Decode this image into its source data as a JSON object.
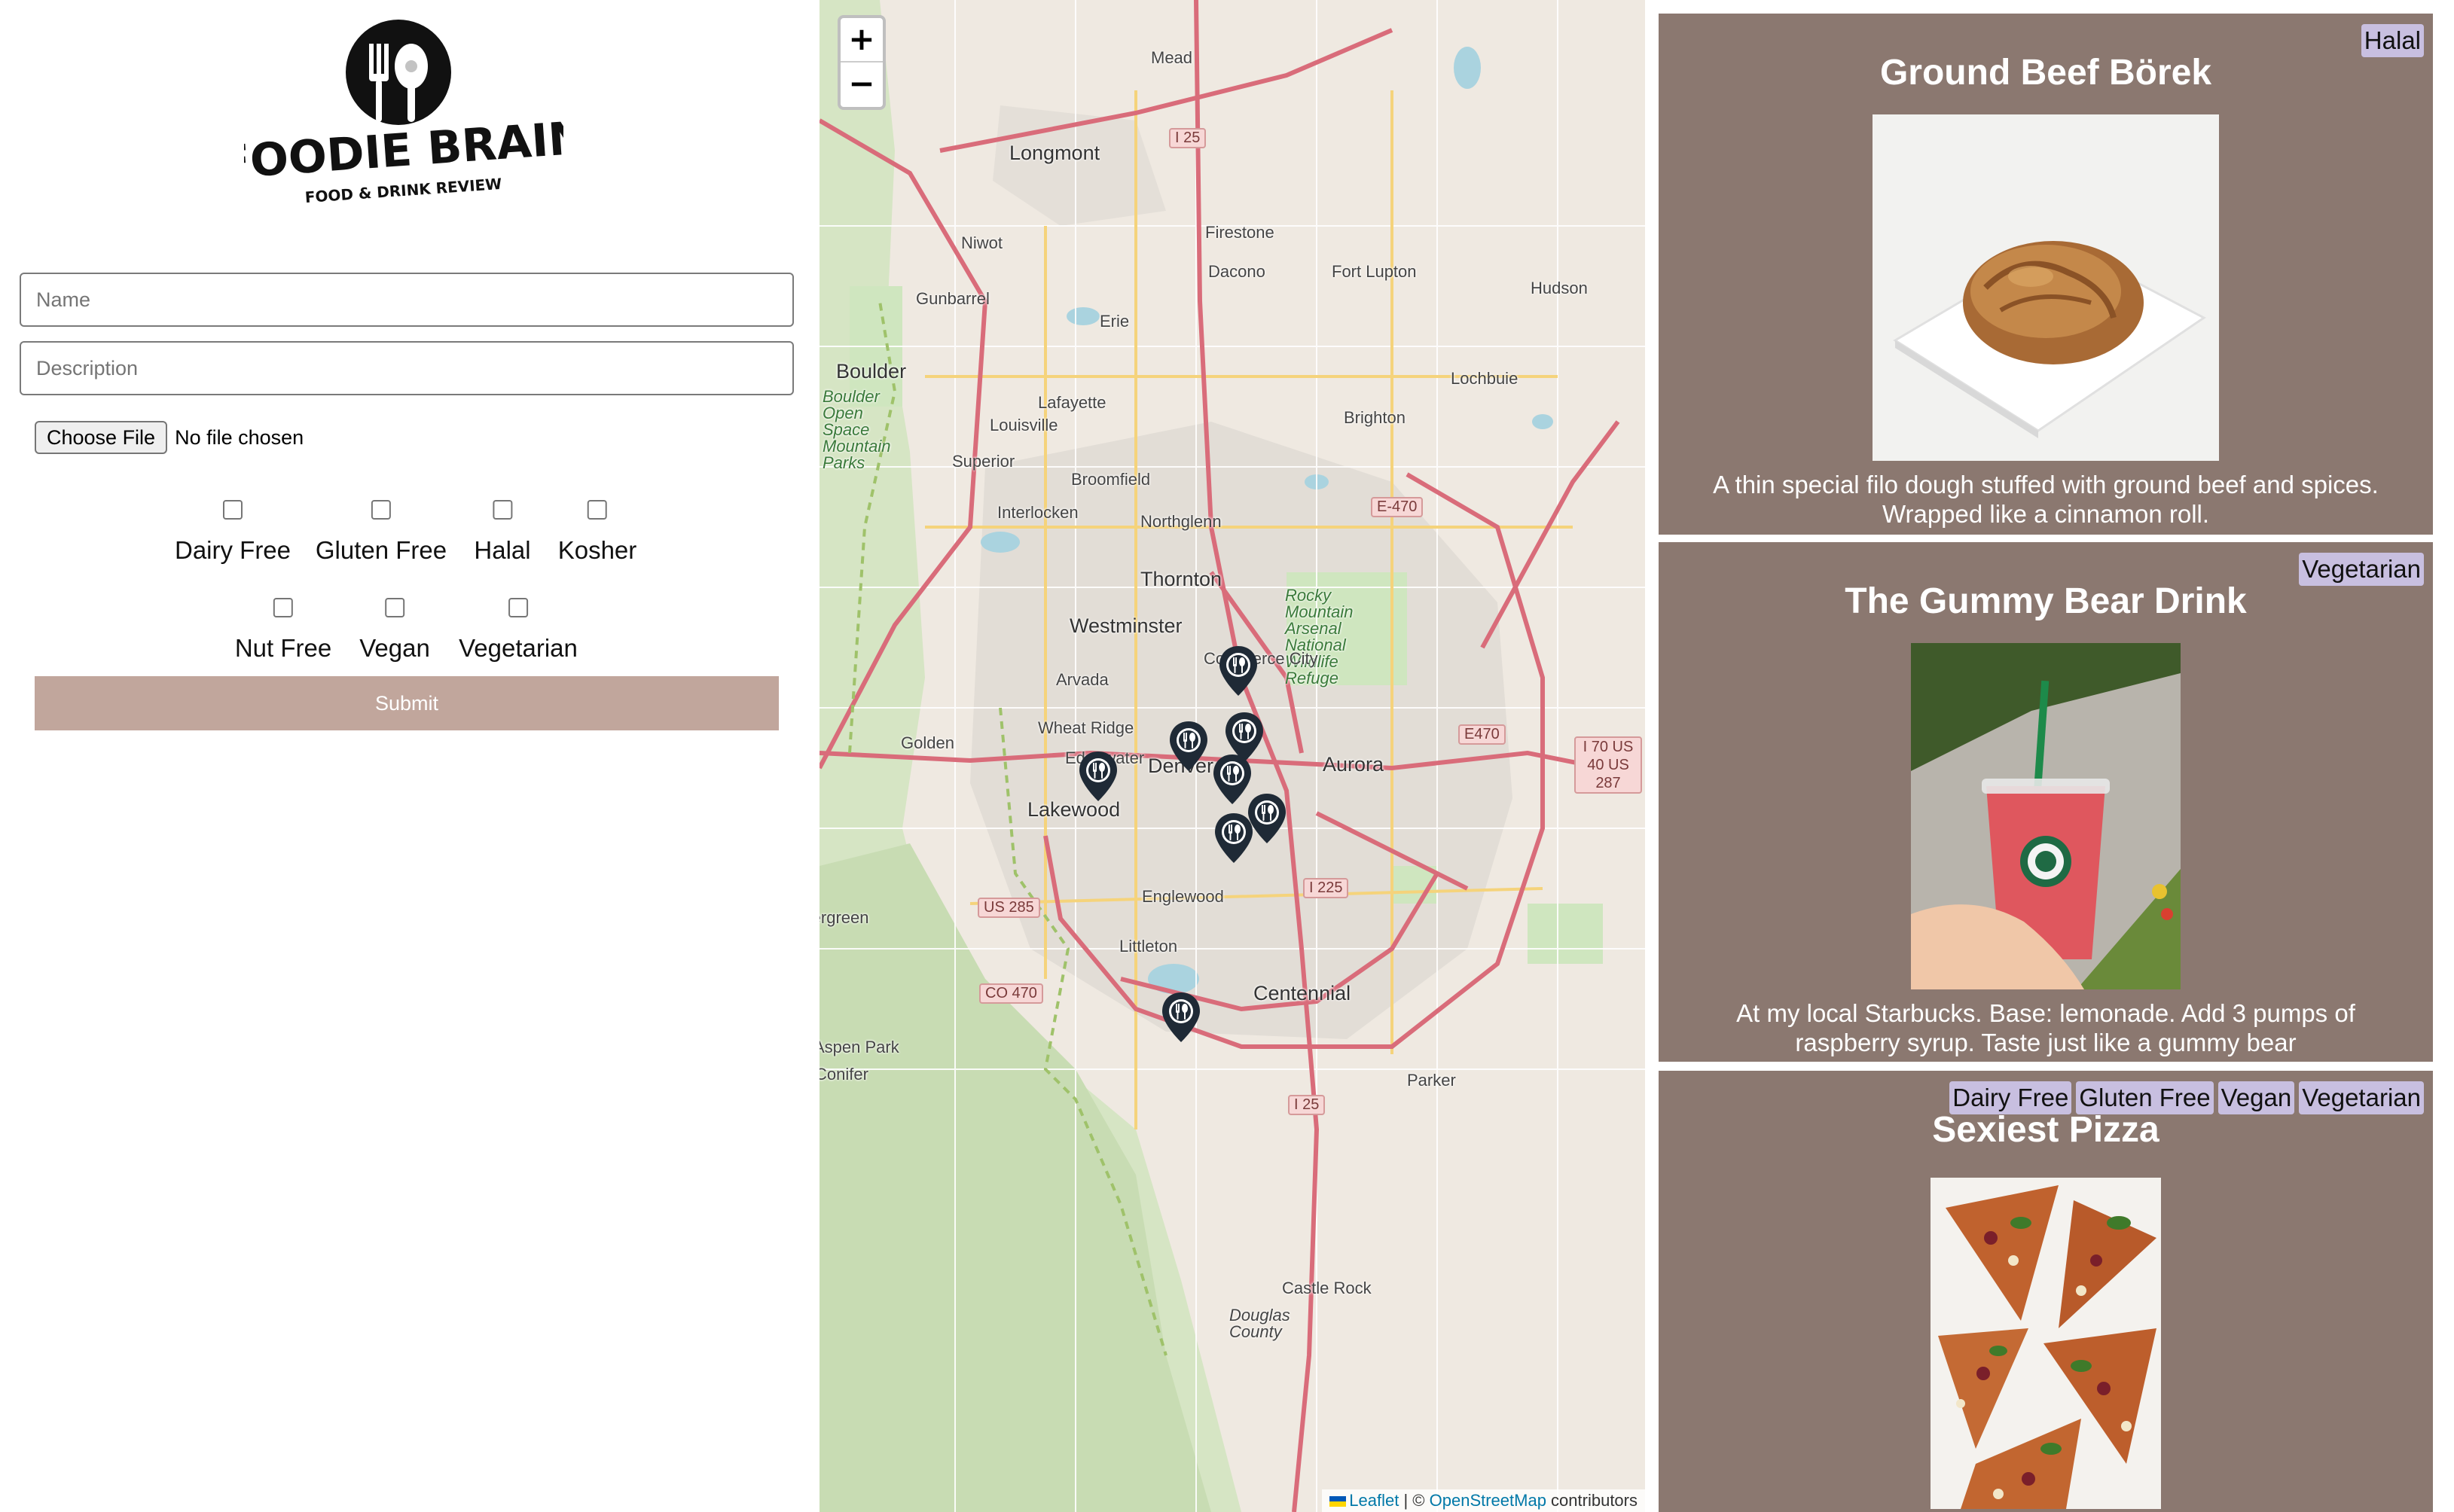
{
  "brand": {
    "name": "FOODIE BRAIN",
    "tagline": "FOOD & DRINK REVIEW"
  },
  "form": {
    "name_placeholder": "Name",
    "description_placeholder": "Description",
    "file_button_label": "Choose File",
    "file_status": "No file chosen",
    "checkbox_row_1": [
      {
        "label": "Dairy Free",
        "checked": false
      },
      {
        "label": "Gluten Free",
        "checked": false
      },
      {
        "label": "Halal",
        "checked": false
      },
      {
        "label": "Kosher",
        "checked": false
      }
    ],
    "checkbox_row_2": [
      {
        "label": "Nut Free",
        "checked": false
      },
      {
        "label": "Vegan",
        "checked": false
      },
      {
        "label": "Vegetarian",
        "checked": false
      }
    ],
    "submit_label": "Submit",
    "submit_color": "#c1a69c"
  },
  "map": {
    "zoom_in_label": "+",
    "zoom_out_label": "−",
    "attribution": {
      "leaflet": "Leaflet",
      "separator": " | © ",
      "osm": "OpenStreetMap",
      "suffix": " contributors"
    },
    "place_labels": {
      "mead": "Mead",
      "longmont": "Longmont",
      "niwot": "Niwot",
      "firestone": "Firestone",
      "dacono": "Dacono",
      "fort_lupton": "Fort Lupton",
      "hudson": "Hudson",
      "gunbarrel": "Gunbarrel",
      "erie": "Erie",
      "boulder": "Boulder",
      "lafayette": "Lafayette",
      "louisville": "Louisville",
      "lochbuie": "Lochbuie",
      "brighton": "Brighton",
      "superior": "Superior",
      "broomfield": "Broomfield",
      "interlocken": "Interlocken",
      "northglenn": "Northglenn",
      "thornton": "Thornton",
      "westminster": "Westminster",
      "rocky_mountain_arsenal": "Rocky Mountain Arsenal National Wildlife Refuge",
      "arvada": "Arvada",
      "commerce_city": "Commerce City",
      "wheat_ridge": "Wheat Ridge",
      "edgewater": "Edgewater",
      "denver": "Denver",
      "aurora": "Aurora",
      "golden": "Golden",
      "lakewood": "Lakewood",
      "englewood": "Englewood",
      "littleton": "Littleton",
      "centennial": "Centennial",
      "parker": "Parker",
      "castle_rock": "Castle Rock",
      "douglas_county": "Douglas County",
      "aspen_park": "Aspen Park",
      "conifer": "Conifer",
      "evergreen": "Evergreen",
      "open_space": "Boulder Open Space Mountain Parks"
    },
    "highway_labels": {
      "i25_north": "I 25",
      "e470_north": "E-470",
      "e470_east": "E470",
      "i70_shield": "I 70 US 40 US 287",
      "us285": "US 285",
      "i225": "I 225",
      "co470": "CO 470",
      "i25_south": "I 25"
    },
    "marker_icon": "fork-knife-pin-icon",
    "marker_count": 8
  },
  "feed": {
    "cards": [
      {
        "title": "Ground Beef Börek",
        "tags": [
          "Halal"
        ],
        "image": "borek-pastry-photo",
        "description": "A thin special filo dough stuffed with ground beef and spices. Wrapped like a cinnamon roll."
      },
      {
        "title": "The Gummy Bear Drink",
        "tags": [
          "Vegetarian"
        ],
        "image": "starbucks-red-drink-photo",
        "description": "At my local Starbucks. Base: lemonade. Add 3 pumps of raspberry syrup. Taste just like a gummy bear"
      },
      {
        "title": "Sexiest Pizza",
        "tags": [
          "Dairy Free",
          "Gluten Free",
          "Vegan",
          "Vegetarian"
        ],
        "image": "pizza-slices-photo",
        "description": ""
      }
    ],
    "card_color": "#8b7870",
    "tag_color": "#c8bfe0"
  }
}
